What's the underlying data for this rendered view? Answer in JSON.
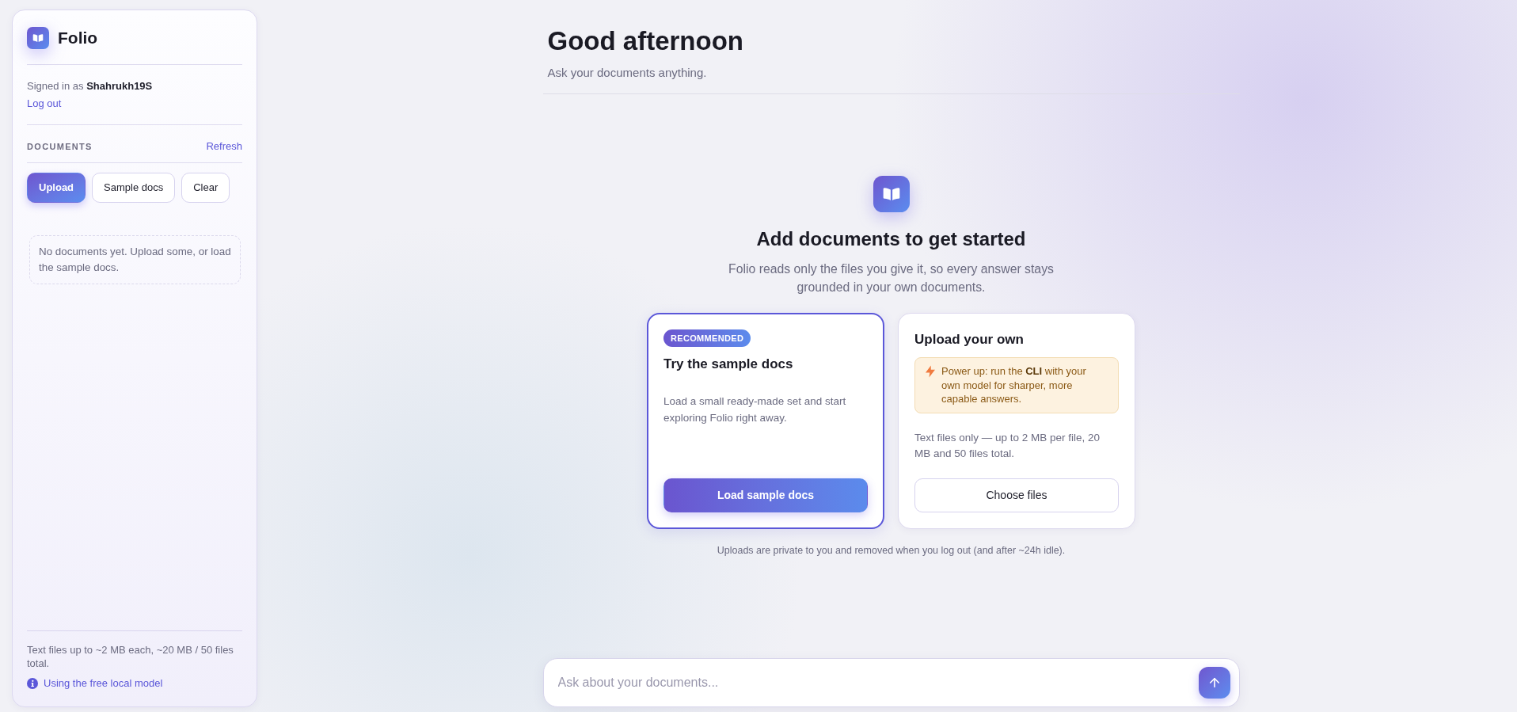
{
  "sidebar": {
    "brand": "Folio",
    "signed_in": "Signed in as **Shahrukh19S**",
    "logout_link": "Log out",
    "section_title": "DOCUMENTS",
    "refresh_link": "Refresh",
    "buttons": [
      {
        "label": "Upload",
        "kind": "primary"
      },
      {
        "label": "Sample docs",
        "kind": "secondary"
      },
      {
        "label": "Clear",
        "kind": "secondary"
      }
    ],
    "empty_message": "No documents yet. Upload some, or load the sample docs.",
    "limits_note": "Text files up to ~2 MB each, ~20 MB / 50 files total.",
    "model_link": "Using the free local model"
  },
  "header": {
    "title": "Good afternoon",
    "subtitle": "Ask your documents anything."
  },
  "empty_state": {
    "title": "Add documents to get started",
    "description": "Folio reads only the files you give it, so every answer stays grounded in your own documents."
  },
  "cards": [
    {
      "badge": "RECOMMENDED",
      "title": "Try the sample docs",
      "description": "Load a small ready-made set and start exploring Folio right away.",
      "button": {
        "label": "Load sample docs",
        "kind": "primary"
      },
      "highlighted": true
    },
    {
      "title": "Upload your own",
      "tip": "Power up: run the **CLI** with your own model for sharper, more capable answers.",
      "description": "Text files only — up to 2 MB per file, 20 MB and 50 files total.",
      "button": {
        "label": "Choose files",
        "kind": "secondary"
      },
      "highlighted": false
    }
  ],
  "footer_note": "Uploads are private to you and removed when you log out (and after ~24h idle).",
  "composer": {
    "placeholder": "Ask about your documents..."
  }
}
